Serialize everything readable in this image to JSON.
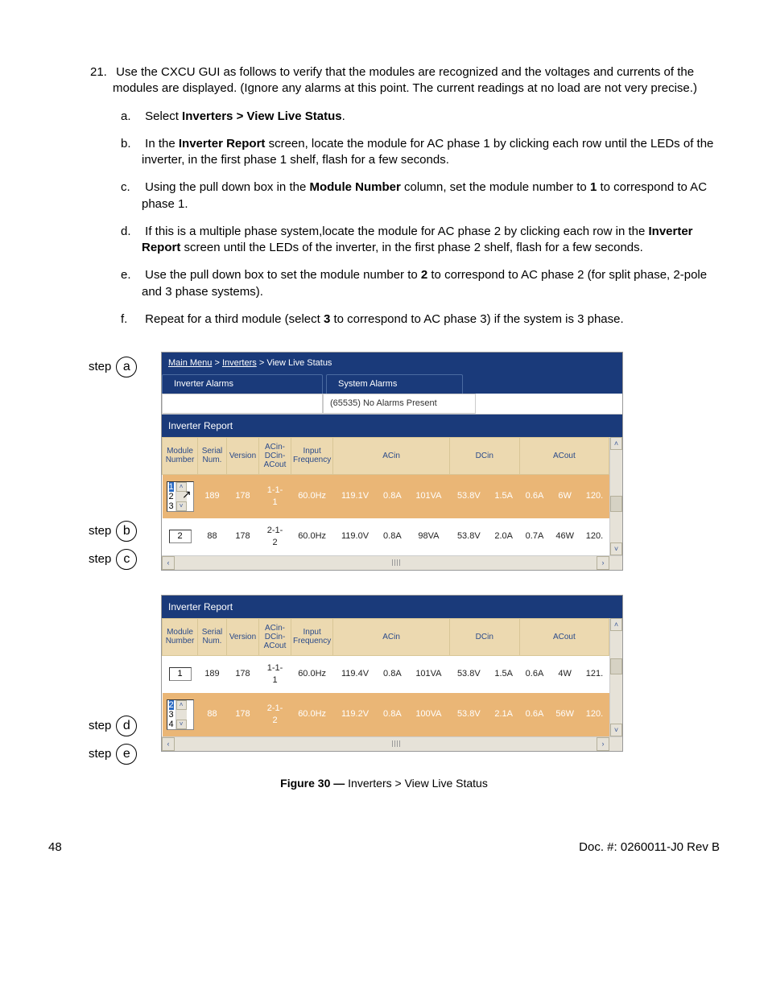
{
  "list": {
    "num": "21.",
    "intro": "Use the CXCU GUI as follows to verify that the modules are recognized and the voltages and currents of the modules are displayed. (Ignore any alarms at this point. The current readings at no load are not very precise.)",
    "items": [
      {
        "lett": "a.",
        "pre": "Select ",
        "bold": "Inverters > View Live Status",
        "post": "."
      },
      {
        "lett": "b.",
        "pre": "In the ",
        "bold": "Inverter Report",
        "post": " screen, locate the module for AC phase 1 by clicking each row until the LEDs of the inverter, in the first phase 1 shelf, flash for a few seconds."
      },
      {
        "lett": "c.",
        "pre": "Using the pull down box in the ",
        "bold": "Module Number",
        "post": " column, set the module number to ",
        "bold2": "1",
        "post2": " to correspond to AC phase 1."
      },
      {
        "lett": "d.",
        "pre": "If this is a multiple phase system,locate the module for AC phase 2 by clicking each row in the ",
        "bold": "Inverter Report",
        "post": " screen until the LEDs of the inverter, in the first phase 2 shelf, flash for a few seconds."
      },
      {
        "lett": "e.",
        "pre": "Use the pull down box to set the module number to ",
        "bold": "2",
        "post": " to correspond to AC phase 2 (for split phase, 2-pole and 3 phase systems)."
      },
      {
        "lett": "f.",
        "pre": "Repeat for a third module (select ",
        "bold": "3",
        "post": " to correspond to AC phase 3) if the system is 3 phase."
      }
    ]
  },
  "labels": {
    "step": "step",
    "a": "a",
    "b": "b",
    "c": "c",
    "d": "d",
    "e": "e"
  },
  "breadcrumb": {
    "main": "Main Menu",
    "inv": "Inverters",
    "view": "View Live Status",
    "sep": " > "
  },
  "tabs": {
    "invAlarms": "Inverter Alarms",
    "sysAlarms": "System Alarms"
  },
  "alarmRow": {
    "code": "(65535) No Alarms Present"
  },
  "report": {
    "title": "Inverter Report"
  },
  "headers": [
    "Module\nNumber",
    "Serial\nNum.",
    "Version",
    "ACin-\nDCin-\nACout",
    "Input\nFrequency",
    "ACin",
    "DCin",
    "ACout"
  ],
  "shot1": {
    "listbox": {
      "opts": [
        "1",
        "2",
        "3"
      ],
      "sel": "1"
    },
    "row1": [
      "",
      "189",
      "178",
      "1-1-\n1",
      "60.0Hz",
      "119.1V",
      "0.8A",
      "101VA",
      "53.8V",
      "1.5A",
      "0.6A",
      "6W",
      "120."
    ],
    "row2box": "2",
    "row2": [
      "",
      "88",
      "178",
      "2-1-\n2",
      "60.0Hz",
      "119.0V",
      "0.8A",
      "98VA",
      "53.8V",
      "2.0A",
      "0.7A",
      "46W",
      "120."
    ]
  },
  "shot2": {
    "row1box": "1",
    "row1": [
      "",
      "189",
      "178",
      "1-1-\n1",
      "60.0Hz",
      "119.4V",
      "0.8A",
      "101VA",
      "53.8V",
      "1.5A",
      "0.6A",
      "4W",
      "121."
    ],
    "listbox": {
      "opts": [
        "2",
        "3",
        "4"
      ],
      "sel": "2"
    },
    "row2": [
      "",
      "88",
      "178",
      "2-1-\n2",
      "60.0Hz",
      "119.2V",
      "0.8A",
      "100VA",
      "53.8V",
      "2.1A",
      "0.6A",
      "56W",
      "120."
    ]
  },
  "caption": {
    "bold": "Figure 30  —",
    "rest": "  Inverters > View Live Status"
  },
  "footer": {
    "page": "48",
    "doc": "Doc. #: 0260011-J0     Rev B"
  }
}
